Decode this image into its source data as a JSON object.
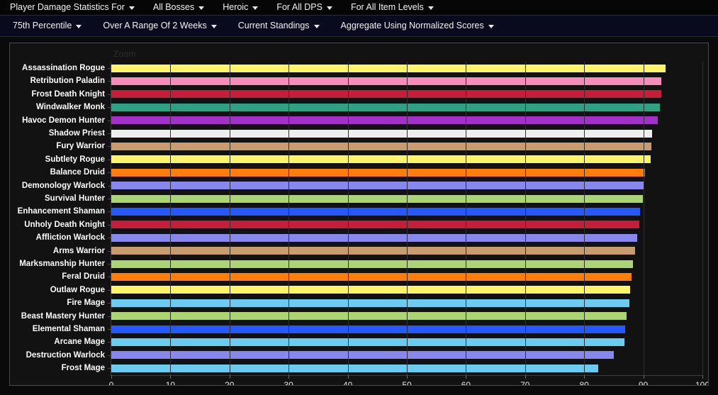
{
  "toolbar_primary": {
    "items": [
      {
        "label": "Player Damage Statistics For",
        "name": "menu-player-damage-statistics"
      },
      {
        "label": "All Bosses",
        "name": "menu-all-bosses"
      },
      {
        "label": "Heroic",
        "name": "menu-heroic"
      },
      {
        "label": "For All DPS",
        "name": "menu-for-all-dps"
      },
      {
        "label": "For All Item Levels",
        "name": "menu-for-all-item-levels"
      }
    ]
  },
  "toolbar_secondary": {
    "items": [
      {
        "label": "75th Percentile",
        "name": "menu-75th-percentile"
      },
      {
        "label": "Over A Range Of 2 Weeks",
        "name": "menu-over-a-range-of-2-weeks"
      },
      {
        "label": "Current Standings",
        "name": "menu-current-standings"
      },
      {
        "label": "Aggregate Using Normalized Scores",
        "name": "menu-aggregate-using-normalized-scores"
      }
    ]
  },
  "chart_panel": {
    "zoom_label": "Zoom"
  },
  "chart_data": {
    "type": "bar",
    "orientation": "horizontal",
    "title": "",
    "xlabel": "",
    "ylabel": "",
    "xlim": [
      0,
      100
    ],
    "xticks": [
      0,
      10,
      20,
      30,
      40,
      50,
      60,
      70,
      80,
      90,
      100
    ],
    "grid": true,
    "legend": "none",
    "categories": [
      "Assassination Rogue",
      "Retribution Paladin",
      "Frost Death Knight",
      "Windwalker Monk",
      "Havoc Demon Hunter",
      "Shadow Priest",
      "Fury Warrior",
      "Subtlety Rogue",
      "Balance Druid",
      "Demonology Warlock",
      "Survival Hunter",
      "Enhancement Shaman",
      "Unholy Death Knight",
      "Affliction Warlock",
      "Arms Warrior",
      "Marksmanship Hunter",
      "Feral Druid",
      "Outlaw Rogue",
      "Fire Mage",
      "Beast Mastery Hunter",
      "Elemental Shaman",
      "Arcane Mage",
      "Destruction Warlock",
      "Frost Mage"
    ],
    "values": [
      93.8,
      93.1,
      93.0,
      92.8,
      92.5,
      91.5,
      91.4,
      91.3,
      90.3,
      90.2,
      89.9,
      89.5,
      89.3,
      89.0,
      88.6,
      88.3,
      88.0,
      87.8,
      87.6,
      87.2,
      86.9,
      86.8,
      85.0,
      82.4
    ],
    "colors": [
      "#fff468",
      "#f58cba",
      "#c41e3a",
      "#2fa082",
      "#a330c9",
      "#eeeeee",
      "#c79c6e",
      "#fff468",
      "#ff7d0a",
      "#8787ed",
      "#abd473",
      "#2459ff",
      "#c41e3a",
      "#8787ed",
      "#c79c6e",
      "#abd473",
      "#ff7d0a",
      "#fff468",
      "#69ccf0",
      "#abd473",
      "#2459ff",
      "#69ccf0",
      "#8787ed",
      "#69ccf0"
    ]
  }
}
